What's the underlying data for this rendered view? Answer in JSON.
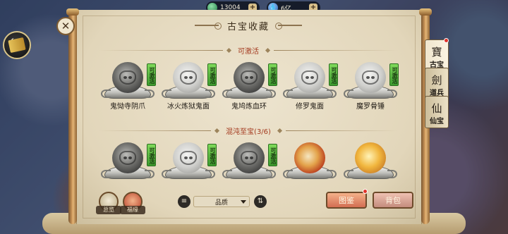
{
  "currency": {
    "jade": {
      "icon": "jade-coin-icon",
      "value": "13004",
      "plus": "+"
    },
    "spirit": {
      "icon": "spirit-drop-icon",
      "value": "6亿",
      "plus": "+"
    }
  },
  "window": {
    "title": "古宝收藏",
    "close_glyph": "✕"
  },
  "sections": {
    "activatable": {
      "header": "可激活",
      "items": [
        {
          "name": "鬼恸寺阴爪",
          "badge": "可激活",
          "style": "dark"
        },
        {
          "name": "冰火炼狱鬼面",
          "badge": "可激活",
          "style": "light"
        },
        {
          "name": "鬼鸠炼血环",
          "badge": "可激活",
          "style": "dark"
        },
        {
          "name": "修罗鬼面",
          "badge": "可激活",
          "style": "light"
        },
        {
          "name": "魔罗骨锤",
          "badge": "可激活",
          "style": "light"
        }
      ]
    },
    "chaos": {
      "header": "混沌至宝(3/6)",
      "items": [
        {
          "name": "",
          "badge": "可激活",
          "style": "dark"
        },
        {
          "name": "",
          "badge": "可激活",
          "style": "light"
        },
        {
          "name": "",
          "badge": "可激活",
          "style": "dark"
        },
        {
          "name": "",
          "badge": "",
          "style": "fire"
        },
        {
          "name": "",
          "badge": "",
          "style": "gold"
        }
      ]
    }
  },
  "toolbar": {
    "overview_label": "总览",
    "blessing_label": "福缘",
    "filter_icon": "filter-icon",
    "quality_value": "品质",
    "sort_icon": "sort-icon",
    "atlas_label": "图鉴",
    "bag_label": "背包"
  },
  "side_tabs": [
    {
      "label": "古宝",
      "glyph": "寶",
      "active": true
    },
    {
      "label": "道兵",
      "glyph": "劍",
      "active": false
    },
    {
      "label": "仙宝",
      "glyph": "仙",
      "active": false
    }
  ],
  "colors": {
    "badge_green": "#5cc04a",
    "section_red": "#a43a1f",
    "paper": "#e8dec6",
    "alert_dot": "#e2332a"
  }
}
